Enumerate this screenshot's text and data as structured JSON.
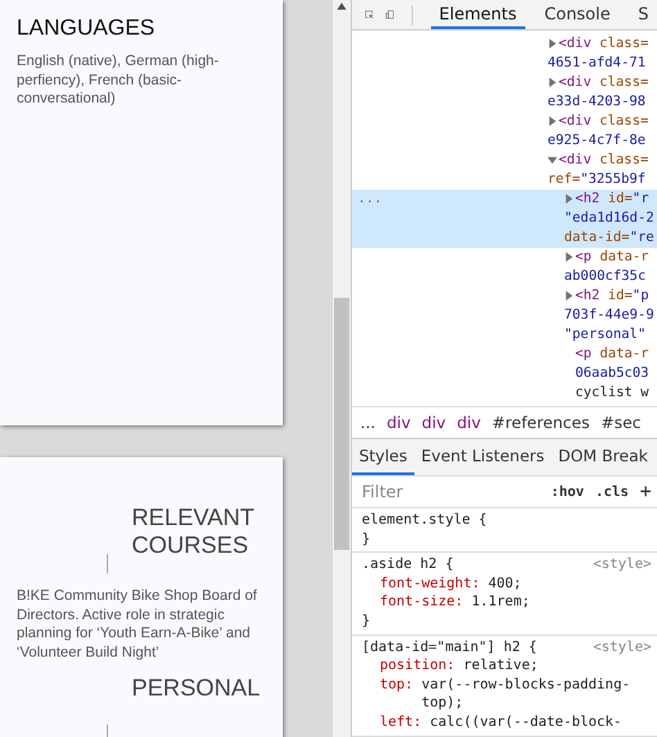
{
  "pages": [
    {
      "blocks": [
        {
          "kind": "heading",
          "text": "LANGUAGES"
        },
        {
          "kind": "paragraph",
          "text": "English (native), German (high-perfiency), French (basic-conversational)"
        }
      ]
    },
    {
      "blocks": [
        {
          "kind": "side-heading",
          "text": "RELEVANT COURSES"
        },
        {
          "kind": "paragraph",
          "text": "B!KE Community Bike Shop Board of Directors. Active role in strategic planning for ‘Youth Earn-A-Bike’ and ‘Volunteer Build Night’"
        },
        {
          "kind": "side-heading",
          "text": "PERSONAL"
        }
      ]
    }
  ],
  "devtools": {
    "tabs": [
      {
        "label": "Elements",
        "selected": true
      },
      {
        "label": "Console",
        "selected": false
      },
      {
        "label": "S",
        "selected": false
      }
    ],
    "selected_marker": "...",
    "dom": [
      {
        "expanded": false,
        "selected": false,
        "lines": [
          [
            {
              "kind": "tag",
              "text": "<div"
            },
            {
              "kind": "attr",
              "text": " class="
            }
          ],
          [
            {
              "kind": "value",
              "text": "4651-afd4-71"
            }
          ]
        ]
      },
      {
        "expanded": false,
        "selected": false,
        "lines": [
          [
            {
              "kind": "tag",
              "text": "<div"
            },
            {
              "kind": "attr",
              "text": " class="
            }
          ],
          [
            {
              "kind": "value",
              "text": "e33d-4203-98"
            }
          ]
        ]
      },
      {
        "expanded": false,
        "selected": false,
        "lines": [
          [
            {
              "kind": "tag",
              "text": "<div"
            },
            {
              "kind": "attr",
              "text": " class="
            }
          ],
          [
            {
              "kind": "value",
              "text": "e925-4c7f-8e"
            }
          ]
        ]
      },
      {
        "expanded": true,
        "selected": false,
        "lines": [
          [
            {
              "kind": "tag",
              "text": "<div"
            },
            {
              "kind": "attr",
              "text": " class="
            }
          ],
          [
            {
              "kind": "attr",
              "text": "ref="
            },
            {
              "kind": "value",
              "text": "\"3255b9f"
            }
          ]
        ],
        "children": [
          {
            "expanded": false,
            "selected": true,
            "lines": [
              [
                {
                  "kind": "tag",
                  "text": "<h2"
                },
                {
                  "kind": "attr",
                  "text": " id="
                },
                {
                  "kind": "value",
                  "text": "\"r"
                }
              ],
              [
                {
                  "kind": "value",
                  "text": "\"eda1d16d-2"
                }
              ],
              [
                {
                  "kind": "attr",
                  "text": "data-id="
                },
                {
                  "kind": "value",
                  "text": "\"re"
                }
              ]
            ]
          },
          {
            "expanded": false,
            "selected": false,
            "lines": [
              [
                {
                  "kind": "tag",
                  "text": "<p"
                },
                {
                  "kind": "attr",
                  "text": " data-r"
                }
              ],
              [
                {
                  "kind": "value",
                  "text": "ab000cf35c"
                }
              ]
            ]
          },
          {
            "expanded": false,
            "selected": false,
            "lines": [
              [
                {
                  "kind": "tag",
                  "text": "<h2"
                },
                {
                  "kind": "attr",
                  "text": " id="
                },
                {
                  "kind": "value",
                  "text": "\"p"
                }
              ],
              [
                {
                  "kind": "value",
                  "text": "703f-44e9-9"
                }
              ],
              [
                {
                  "kind": "value",
                  "text": "\"personal\""
                }
              ]
            ]
          },
          {
            "selected": false,
            "lines": [
              [
                {
                  "kind": "tag",
                  "text": "<p"
                },
                {
                  "kind": "attr",
                  "text": " data-r"
                }
              ],
              [
                {
                  "kind": "value",
                  "text": "06aab5c03"
                }
              ],
              [
                {
                  "kind": "text",
                  "text": "cyclist w"
                }
              ]
            ]
          }
        ]
      }
    ],
    "breadcrumbs": [
      {
        "kind": "more",
        "text": "..."
      },
      {
        "kind": "tag",
        "text": "div"
      },
      {
        "kind": "tag",
        "text": "div"
      },
      {
        "kind": "tag",
        "text": "div"
      },
      {
        "kind": "id",
        "text": "#references"
      },
      {
        "kind": "id",
        "text": "#sec"
      }
    ],
    "style_tabs": [
      {
        "label": "Styles",
        "selected": true
      },
      {
        "label": "Event Listeners",
        "selected": false
      },
      {
        "label": "DOM Break",
        "selected": false
      }
    ],
    "filter": {
      "placeholder": "Filter",
      "hov": ":hov",
      "cls": ".cls",
      "add": "+"
    },
    "rules": [
      {
        "selector": "element.style {",
        "close": "}"
      },
      {
        "selector": ".aside h2 {",
        "source": "<style>",
        "close": "}",
        "declarations": [
          {
            "property": "font-weight:",
            "value": "400;"
          },
          {
            "property": "font-size:",
            "value": "1.1rem;"
          }
        ]
      },
      {
        "selector": "[data-id=\"main\"] h2 {",
        "source": "<style>",
        "declarations": [
          {
            "property": "position:",
            "value": "relative;"
          },
          {
            "property": "top:",
            "value": "var(--row-blocks-padding-top);"
          },
          {
            "property": "left:",
            "value": "calc((var(--date-block-"
          }
        ]
      }
    ]
  }
}
